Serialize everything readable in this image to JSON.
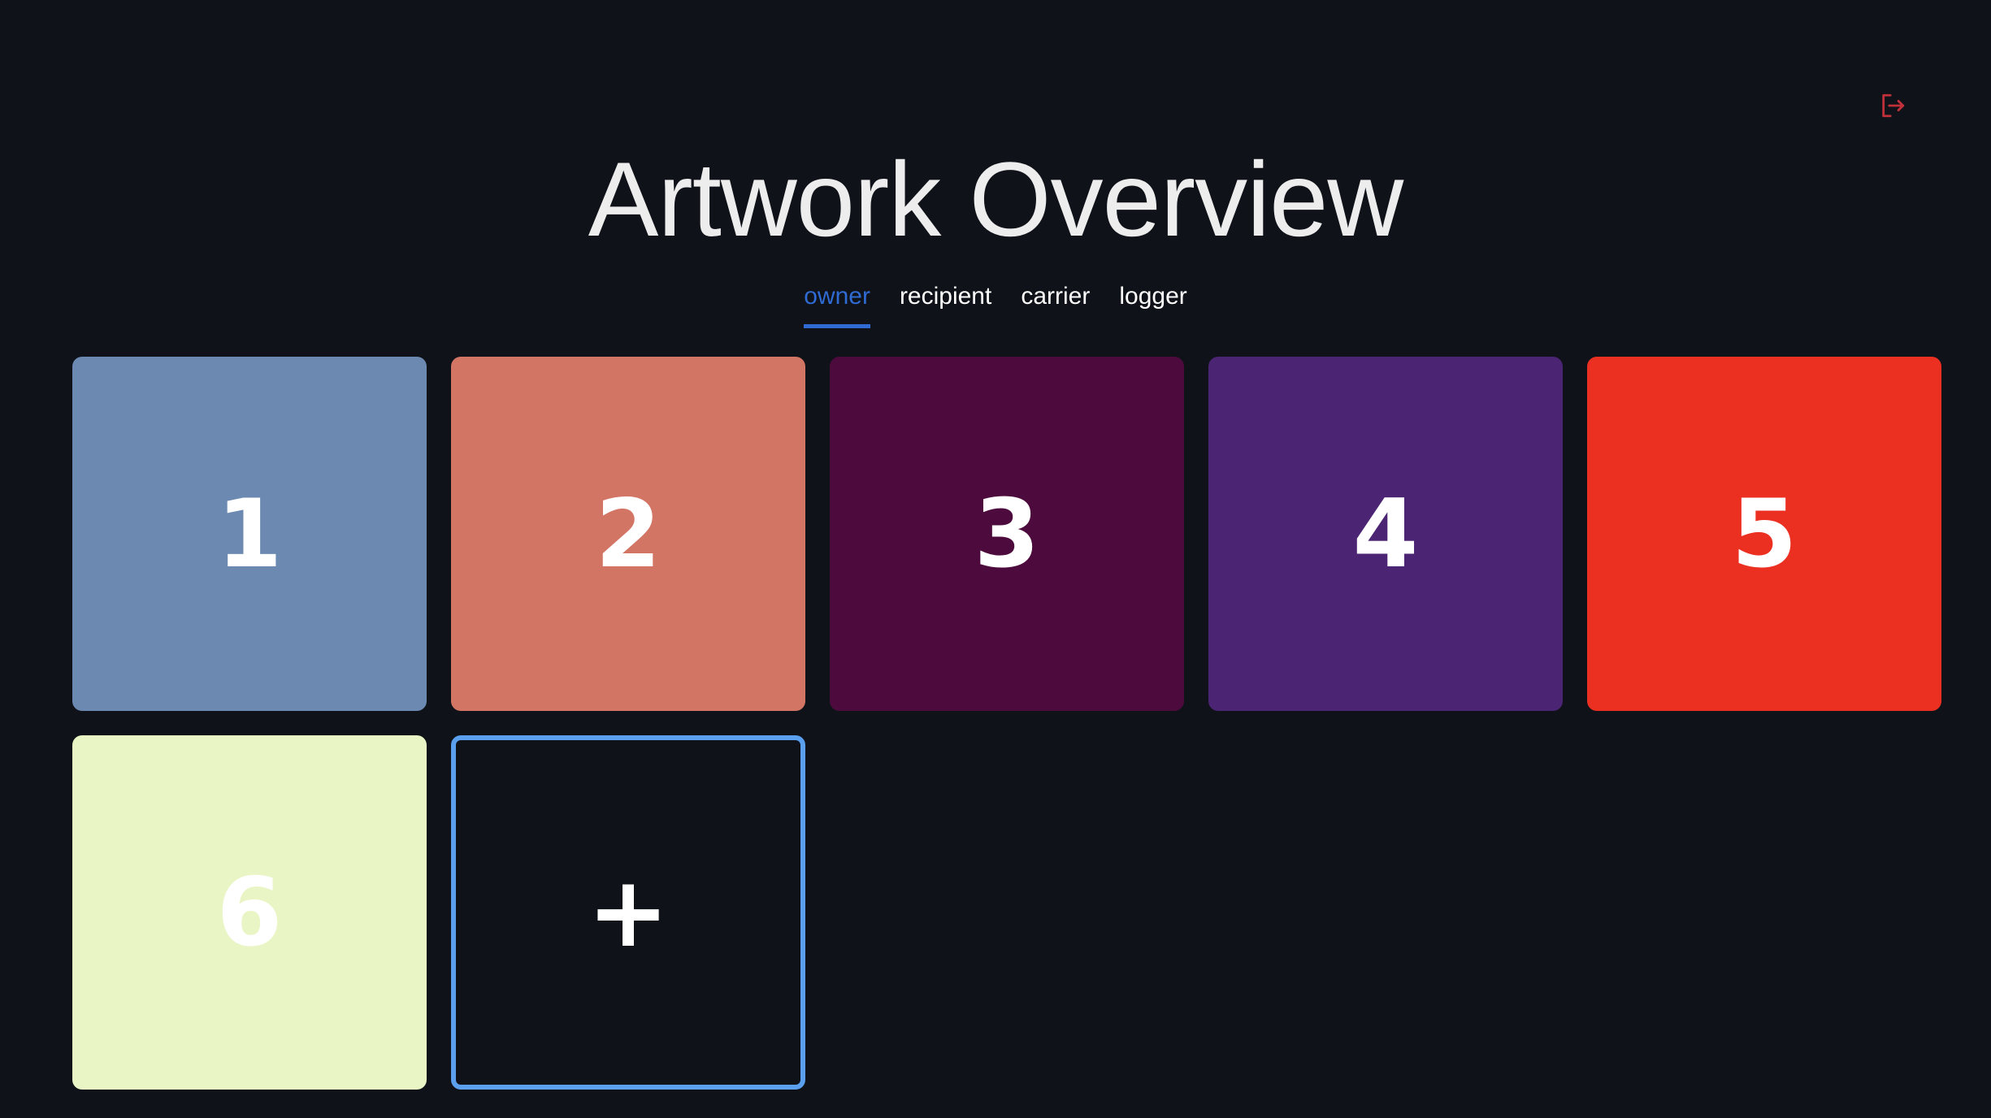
{
  "header": {
    "title": "Artwork Overview",
    "logout_icon": "logout-icon",
    "logout_color": "#c0303a"
  },
  "tabs": [
    {
      "label": "owner",
      "active": true
    },
    {
      "label": "recipient",
      "active": false
    },
    {
      "label": "carrier",
      "active": false
    },
    {
      "label": "logger",
      "active": false
    }
  ],
  "artworks": [
    {
      "label": "1",
      "color": "#6b89b1"
    },
    {
      "label": "2",
      "color": "#d37565"
    },
    {
      "label": "3",
      "color": "#4d0b3d"
    },
    {
      "label": "4",
      "color": "#4b2573"
    },
    {
      "label": "5",
      "color": "#eb3022"
    },
    {
      "label": "6",
      "color": "#e9f5c4"
    }
  ],
  "add_tile": {
    "label": "+",
    "border_color": "#5aa0ee"
  },
  "colors": {
    "background": "#0f1218",
    "accent": "#2f6bd3"
  }
}
